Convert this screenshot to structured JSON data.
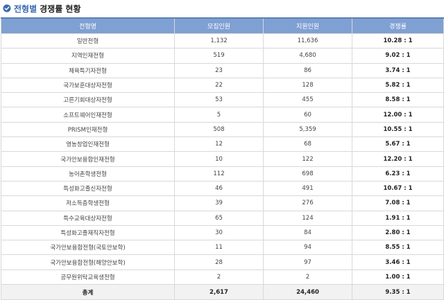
{
  "title": {
    "accent": "전형별",
    "rest": "경쟁률 현황"
  },
  "columns": [
    "전형명",
    "모집인원",
    "지원인원",
    "경쟁률"
  ],
  "rows": [
    {
      "name": "일반전형",
      "quota": "1,132",
      "applicants": "11,636",
      "ratio": "10.28 : 1"
    },
    {
      "name": "지역인재전형",
      "quota": "519",
      "applicants": "4,680",
      "ratio": "9.02 : 1"
    },
    {
      "name": "체육특기자전형",
      "quota": "23",
      "applicants": "86",
      "ratio": "3.74 : 1"
    },
    {
      "name": "국가보훈대상자전형",
      "quota": "22",
      "applicants": "128",
      "ratio": "5.82 : 1"
    },
    {
      "name": "고른기회대상자전형",
      "quota": "53",
      "applicants": "455",
      "ratio": "8.58 : 1"
    },
    {
      "name": "소프트웨어인재전형",
      "quota": "5",
      "applicants": "60",
      "ratio": "12.00 : 1"
    },
    {
      "name": "PRISM인재전형",
      "quota": "508",
      "applicants": "5,359",
      "ratio": "10.55 : 1"
    },
    {
      "name": "영농창업인재전형",
      "quota": "12",
      "applicants": "68",
      "ratio": "5.67 : 1"
    },
    {
      "name": "국가안보융합인재전형",
      "quota": "10",
      "applicants": "122",
      "ratio": "12.20 : 1"
    },
    {
      "name": "농어촌학생전형",
      "quota": "112",
      "applicants": "698",
      "ratio": "6.23 : 1"
    },
    {
      "name": "특성화고졸신자전형",
      "quota": "46",
      "applicants": "491",
      "ratio": "10.67 : 1"
    },
    {
      "name": "저소득층학생전형",
      "quota": "39",
      "applicants": "276",
      "ratio": "7.08 : 1"
    },
    {
      "name": "특수교육대상자전형",
      "quota": "65",
      "applicants": "124",
      "ratio": "1.91 : 1"
    },
    {
      "name": "특성화고졸재직자전형",
      "quota": "30",
      "applicants": "84",
      "ratio": "2.80 : 1"
    },
    {
      "name": "국가안보융합전형(국토안보학)",
      "quota": "11",
      "applicants": "94",
      "ratio": "8.55 : 1"
    },
    {
      "name": "국가안보융합전형(해양안보학)",
      "quota": "28",
      "applicants": "97",
      "ratio": "3.46 : 1"
    },
    {
      "name": "공무원위탁교육생전형",
      "quota": "2",
      "applicants": "2",
      "ratio": "1.00 : 1"
    }
  ],
  "total": {
    "name": "총계",
    "quota": "2,617",
    "applicants": "24,460",
    "ratio": "9.35 : 1"
  },
  "colors": {
    "header_bg": "#7fa0d2",
    "accent": "#3a6bb0",
    "total_bg": "#f2f2f2",
    "border": "#d8d8d8"
  },
  "icons": {
    "title": "check-circle-icon"
  }
}
